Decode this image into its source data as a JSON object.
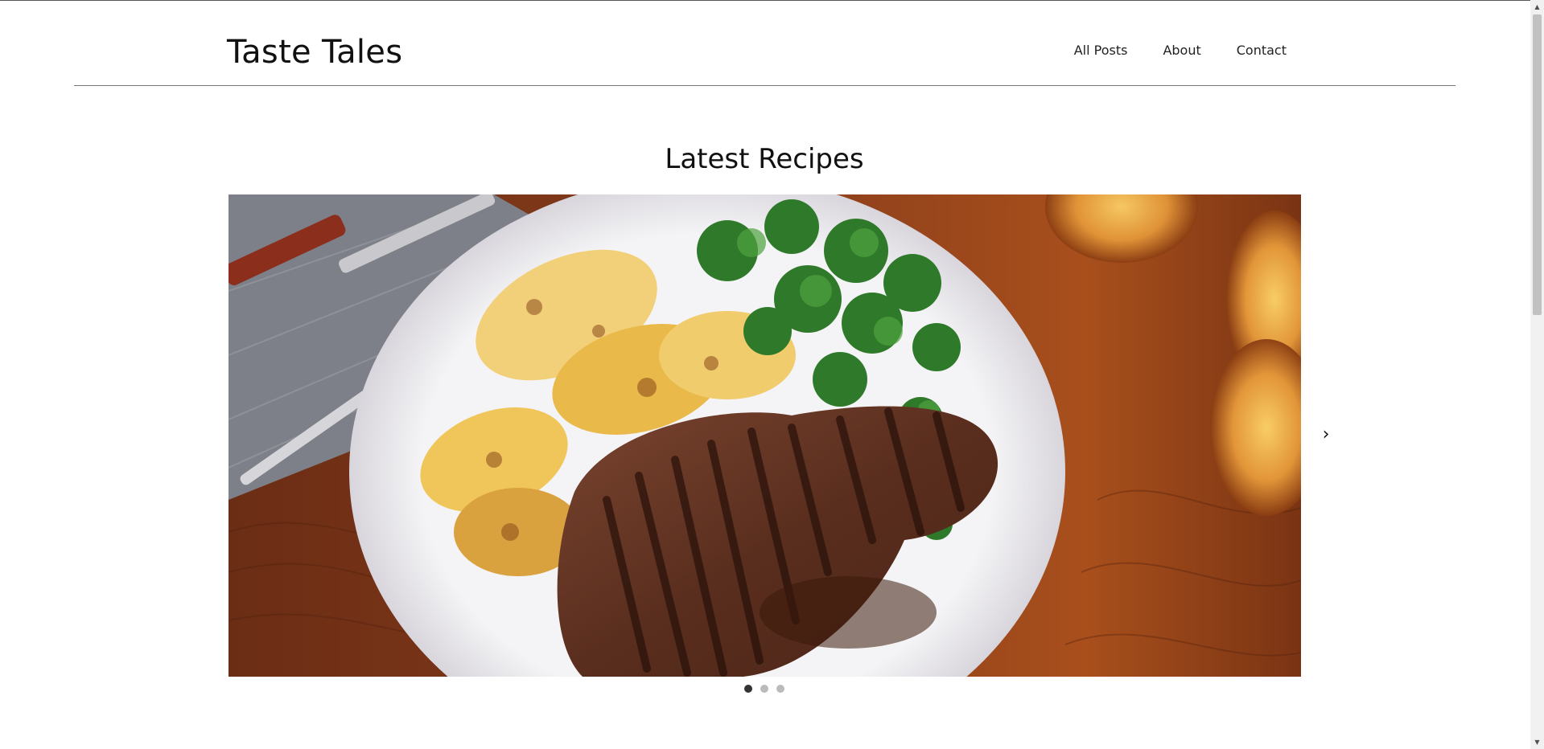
{
  "header": {
    "brand": "Taste Tales",
    "nav": [
      {
        "label": "All Posts"
      },
      {
        "label": "About"
      },
      {
        "label": "Contact"
      }
    ]
  },
  "main": {
    "section_title": "Latest Recipes",
    "carousel": {
      "slide_count": 3,
      "active_index": 0,
      "next_icon": "chevron-right-icon",
      "slide_subject": "grilled steak with potato gratin and watercress salad"
    }
  },
  "colors": {
    "text": "#111111",
    "divider": "#777777",
    "dot_active": "#333333",
    "dot_inactive": "#bbbbbb"
  }
}
